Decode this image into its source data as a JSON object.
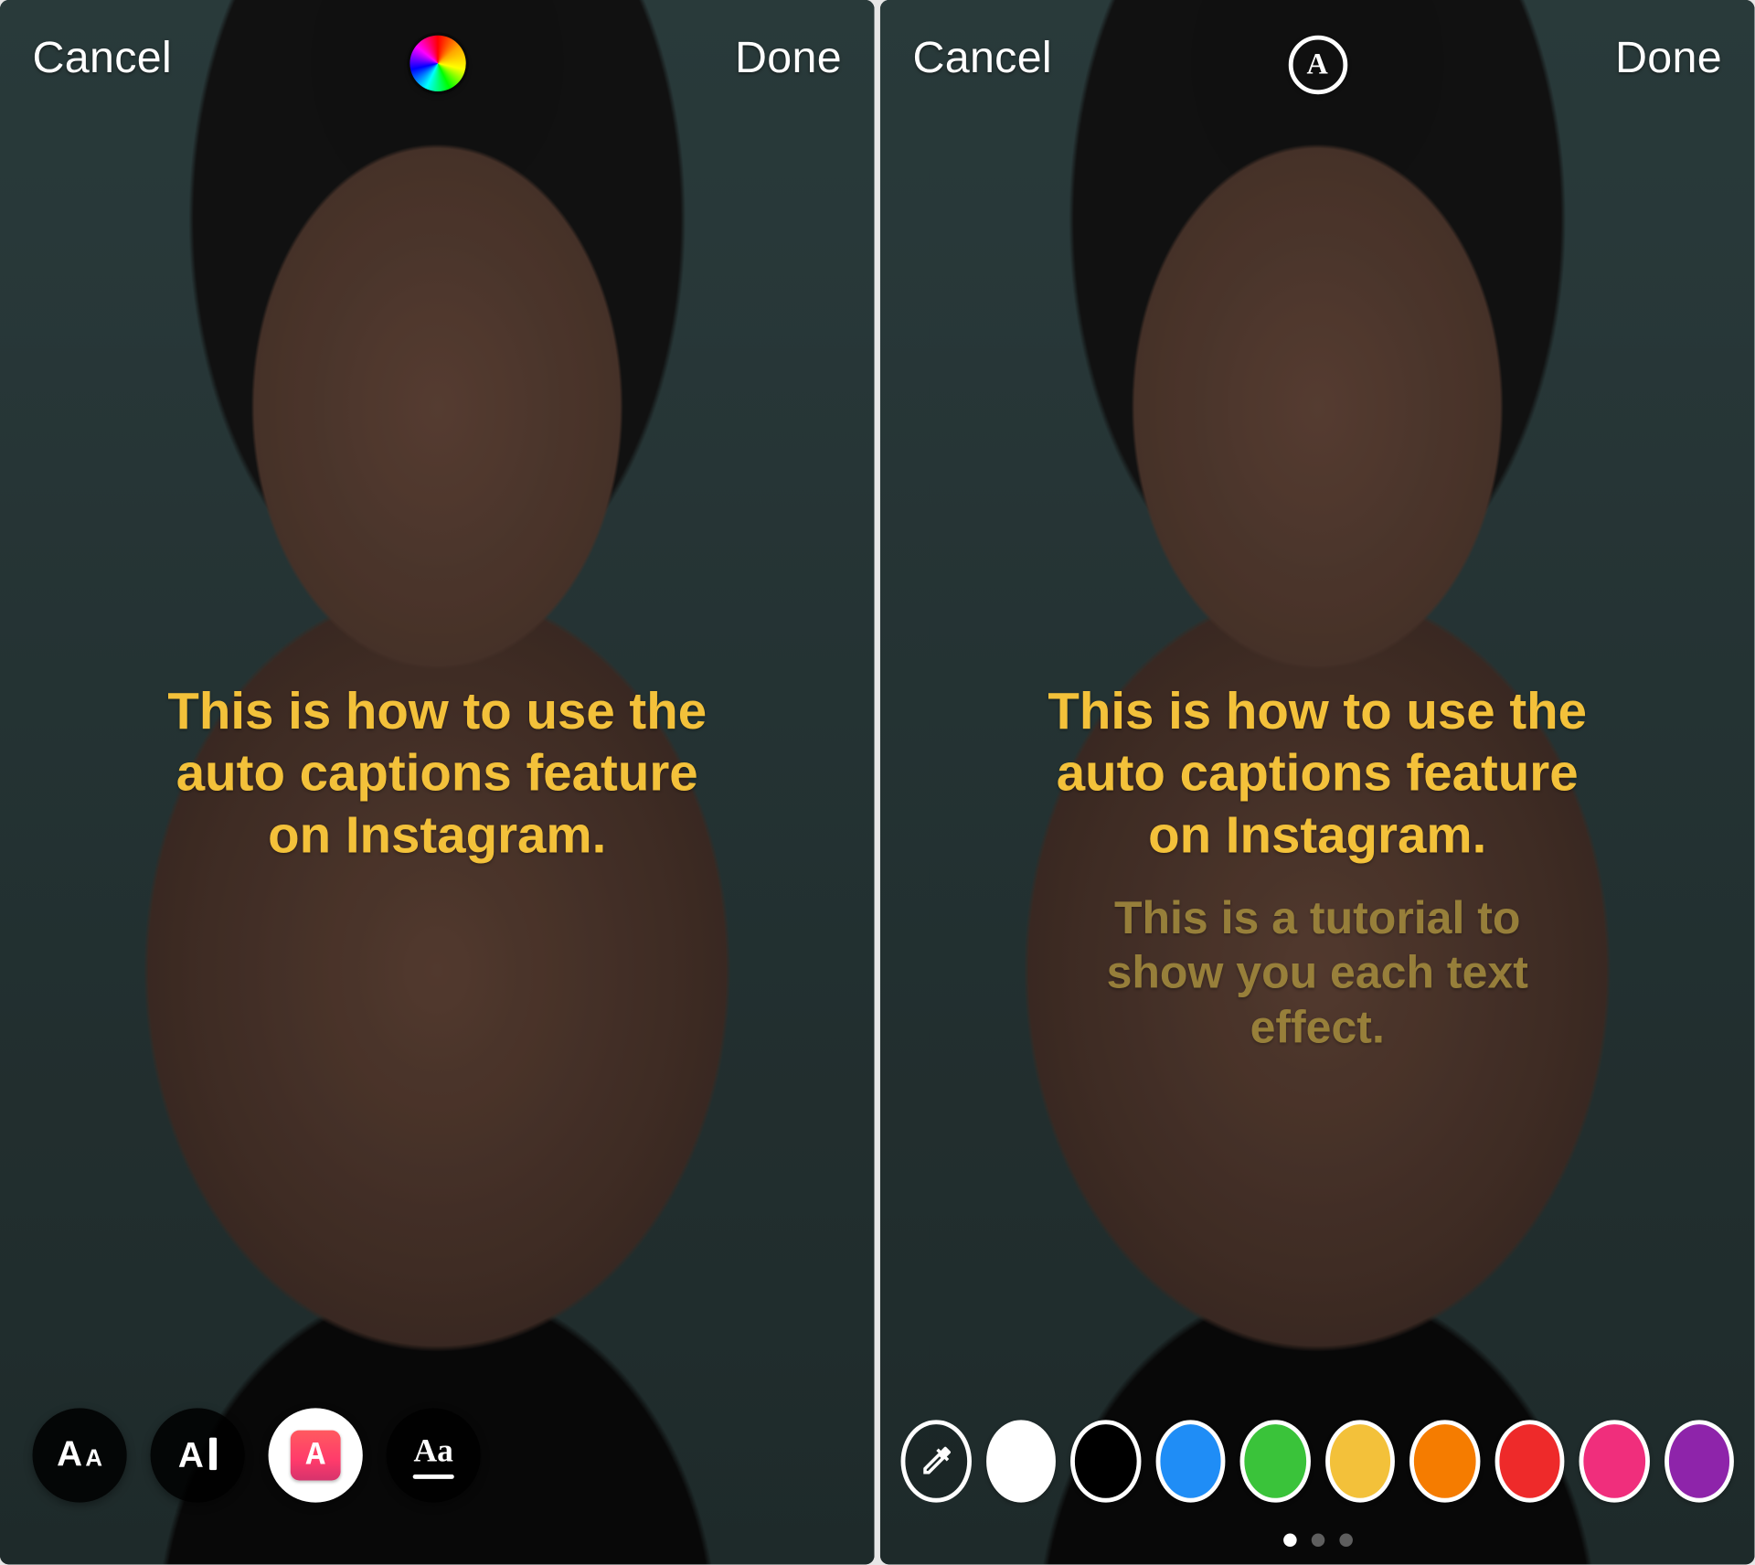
{
  "left": {
    "header": {
      "cancel": "Cancel",
      "done": "Done",
      "center_icon": "color-wheel-icon"
    },
    "caption": {
      "primary": "This is how to use the\nauto captions feature\non Instagram."
    },
    "style_tray": {
      "items": [
        {
          "name": "text-style-size",
          "icon": "aa-scale-icon",
          "selected": false
        },
        {
          "name": "text-style-cursor",
          "icon": "aa-cursor-icon",
          "selected": false
        },
        {
          "name": "text-style-highlight",
          "icon": "a-gradient-icon",
          "selected": true
        },
        {
          "name": "text-style-serif",
          "icon": "aa-underline-icon",
          "selected": false
        }
      ]
    }
  },
  "right": {
    "header": {
      "cancel": "Cancel",
      "done": "Done",
      "center_icon": "text-style-ring-icon",
      "center_glyph": "A"
    },
    "caption": {
      "primary": "This is how to use the\nauto captions feature\non Instagram.",
      "secondary": "This is a tutorial to\nshow you  each text\neffect."
    },
    "color_tray": {
      "has_eyedropper": true,
      "colors": [
        "#ffffff",
        "#000000",
        "#1f8df6",
        "#3ac33a",
        "#f3c13a",
        "#f57c00",
        "#ee2a2a",
        "#f02e7c",
        "#8e24aa"
      ],
      "page_count": 3,
      "page_active_index": 0
    }
  }
}
